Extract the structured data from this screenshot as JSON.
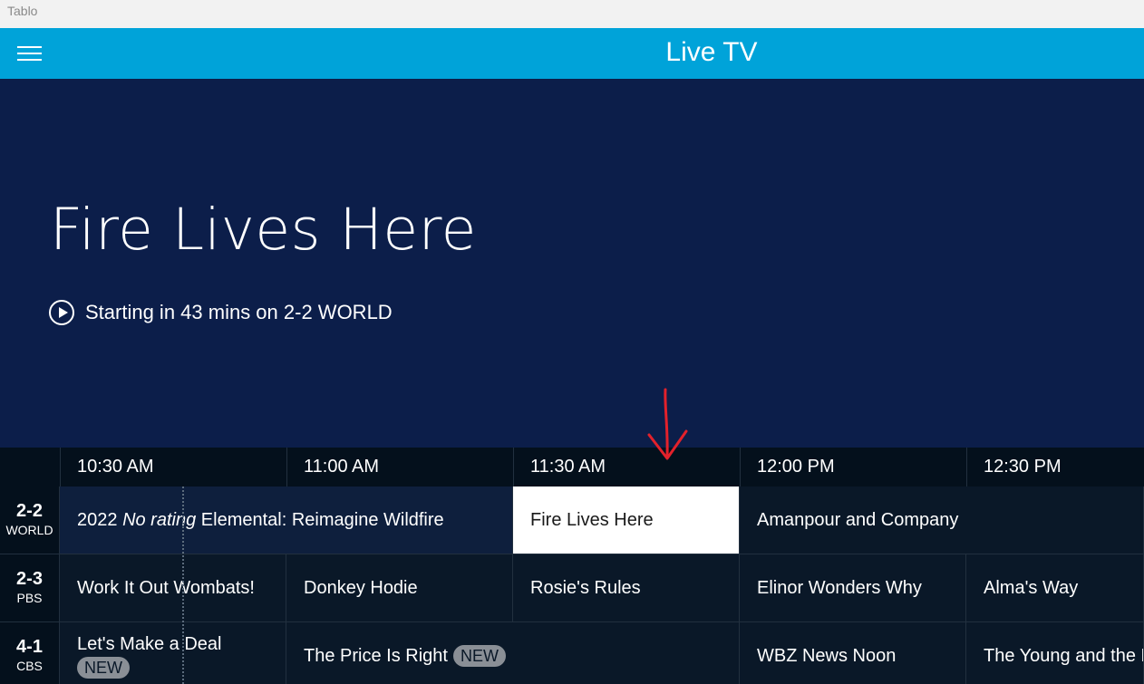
{
  "window": {
    "title": "Tablo"
  },
  "topbar": {
    "title": "Live TV",
    "menu_icon": "hamburger-menu-icon"
  },
  "hero": {
    "title": "Fire Lives Here",
    "subtitle": "Starting in 43 mins on 2-2 WORLD",
    "play_icon": "play-circle-icon"
  },
  "guide": {
    "times": [
      "10:30 AM",
      "11:00 AM",
      "11:30 AM",
      "12:00 PM",
      "12:30 PM"
    ],
    "channels": [
      {
        "number": "2-2",
        "name": "WORLD"
      },
      {
        "number": "2-3",
        "name": "PBS"
      },
      {
        "number": "4-1",
        "name": "CBS"
      }
    ],
    "rows": [
      {
        "first": {
          "year": "2022",
          "rating": "No rating",
          "title": "Elemental: Reimagine Wildfire"
        },
        "selected": "Fire Lives Here",
        "next": "Amanpour and Company"
      },
      {
        "programs": [
          "Work It Out Wombats!",
          "Donkey Hodie",
          "Rosie's Rules",
          "Elinor Wonders Why",
          "Alma's Way"
        ]
      },
      {
        "first": {
          "title": "Let's Make a Deal",
          "badge": "NEW"
        },
        "second": {
          "title": "The Price Is Right",
          "badge": "NEW"
        },
        "third": "WBZ News Noon",
        "fourth": "The Young and the Restless"
      }
    ]
  },
  "colors": {
    "topbar": "#00a3d9",
    "hero_bg": "#0c1e4a",
    "guide_bg": "#050f1c",
    "selected_cell": "#ffffff",
    "annotation_arrow": "#e3212b"
  }
}
